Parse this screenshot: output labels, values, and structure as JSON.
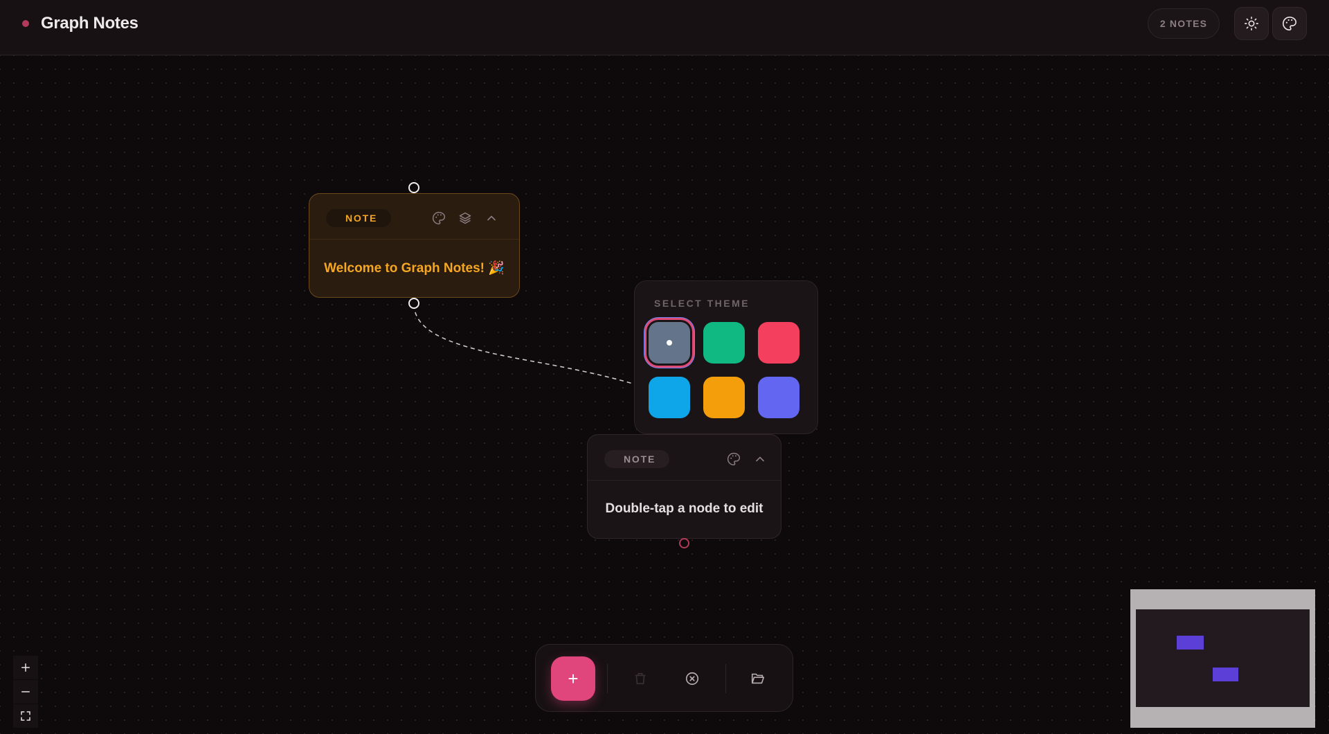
{
  "app": {
    "title": "Graph Notes"
  },
  "header": {
    "note_count": "2 NOTES",
    "buttons": [
      {
        "name": "theme-toggle",
        "icon": "sun-icon"
      },
      {
        "name": "palette",
        "icon": "palette-icon"
      }
    ]
  },
  "nodes": [
    {
      "tag": "NOTE",
      "text": "Welcome to Graph Notes! 🎉",
      "color": "#f5a623",
      "actions": [
        "palette-icon",
        "layers-icon",
        "chevron-up-icon"
      ]
    },
    {
      "tag": "NOTE",
      "text": "Double-tap a node to edit",
      "color": "#e6dfe2",
      "actions": [
        "palette-icon",
        "chevron-up-icon"
      ]
    }
  ],
  "theme_picker": {
    "title": "SELECT THEME",
    "selected_index": 0,
    "swatches": [
      {
        "name": "slate",
        "color": "#64748b"
      },
      {
        "name": "emerald",
        "color": "#10b981"
      },
      {
        "name": "rose",
        "color": "#f43f5e"
      },
      {
        "name": "sky",
        "color": "#0ea5e9"
      },
      {
        "name": "amber",
        "color": "#f59e0b"
      },
      {
        "name": "indigo",
        "color": "#6366f1"
      }
    ]
  },
  "toolbar": {
    "add_label": "+",
    "actions": [
      "trash-icon",
      "clear-icon",
      "folder-open-icon"
    ]
  },
  "zoom_controls": [
    "zoom-in-icon",
    "zoom-out-icon",
    "fit-view-icon"
  ],
  "minimap": {
    "node_color": "#5b3fd6"
  },
  "colors": {
    "accent": "#e0457b",
    "background": "#0e0a0b"
  }
}
